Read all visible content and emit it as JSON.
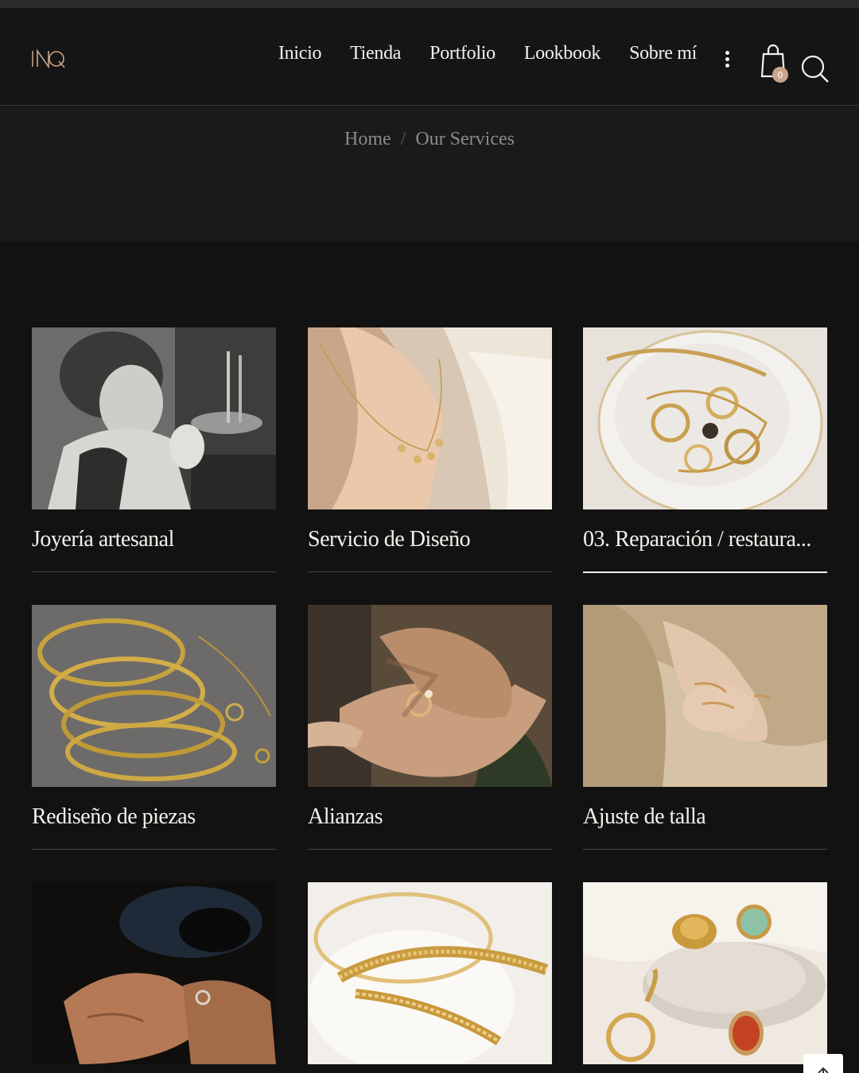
{
  "header": {
    "nav": [
      "Inicio",
      "Tienda",
      "Portfolio",
      "Lookbook",
      "Sobre mí"
    ],
    "cart_count": "0"
  },
  "breadcrumb": {
    "home": "Home",
    "separator": "/",
    "current": "Our Services"
  },
  "services": [
    {
      "title": "Joyería artesanal"
    },
    {
      "title": "Servicio de Diseño"
    },
    {
      "title": "03.  Reparación / restaura..."
    },
    {
      "title": "Rediseño de piezas"
    },
    {
      "title": "Alianzas"
    },
    {
      "title": "Ajuste de talla"
    },
    {
      "title": ""
    },
    {
      "title": ""
    },
    {
      "title": ""
    }
  ],
  "colors": {
    "background": "#131212",
    "accent": "#c9a48b",
    "text": "#f4f1ec"
  }
}
